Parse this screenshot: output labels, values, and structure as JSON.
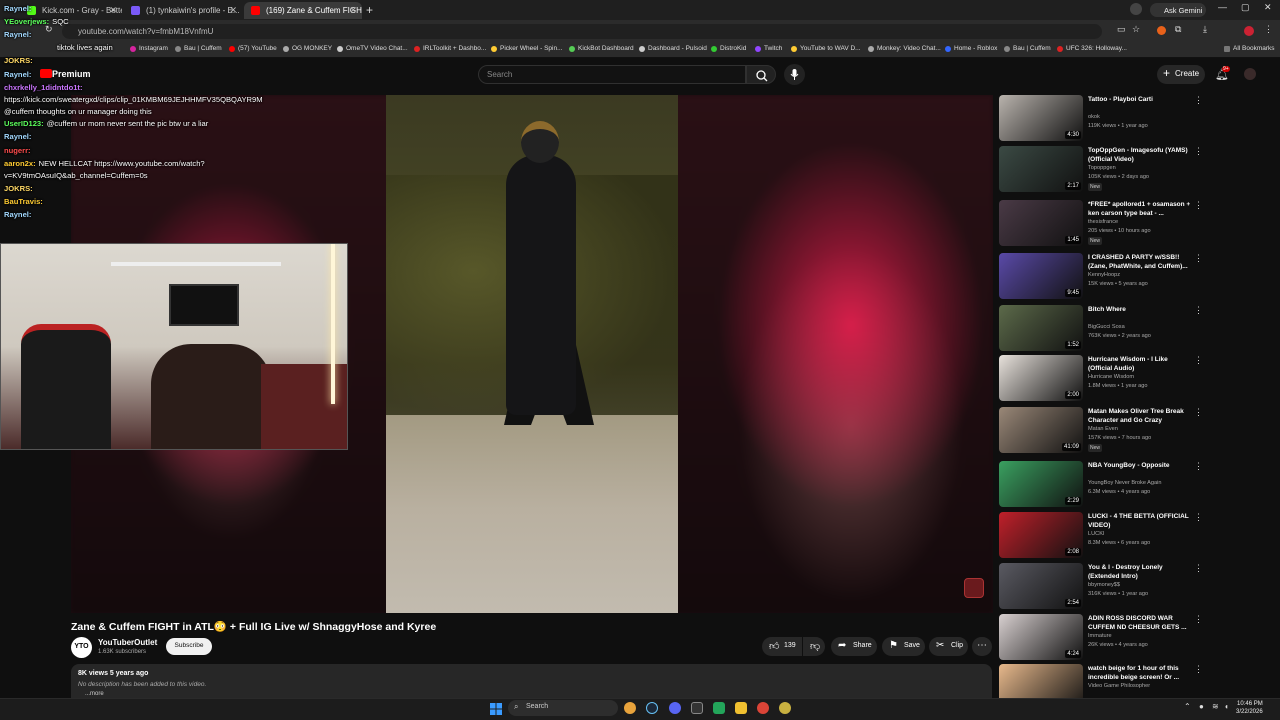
{
  "browser": {
    "tabs": [
      {
        "label": "Kick.com - Gray - Better Than You",
        "color": "#53fc18"
      },
      {
        "label": "(1) tynkaiwin's profile - E...",
        "color": "#7a5af8"
      },
      {
        "label": "(169) Zane & Cuffem FIGHT in...",
        "color": "#ff0000"
      }
    ],
    "url": "youtube.com/watch?v=fmbM18VnfmU",
    "ask_gemini": "Ask Gemini",
    "bookmarks": [
      "Instagram",
      "Bau | Cuffem",
      "(57) YouTube",
      "OG MONKEY",
      "OmeTV Video Chat...",
      "IRLToolkit + Dashbo...",
      "Picker Wheel - Spin...",
      "KickBot Dashboard",
      "Dashboard - Pulsoid",
      "DistroKid",
      "Twitch",
      "YouTube to WAV D...",
      "Monkey: Video Chat...",
      "Home - Roblox",
      "Bau | Cuffem",
      "UFC 326: Holloway..."
    ],
    "all_bookmarks": "All Bookmarks"
  },
  "youtube": {
    "logo_text": "Premium",
    "search_placeholder": "Search",
    "create_label": "Create",
    "notif_count": "9+"
  },
  "chat": [
    {
      "user": "Raynel:",
      "msg": "",
      "color": "#a3d9ff"
    },
    {
      "user": "YEoverjews:",
      "msg": "SQC",
      "color": "#5cff5c"
    },
    {
      "user": "Raynel:",
      "msg": "",
      "color": "#a3d9ff"
    },
    {
      "user": "tiktok lives again",
      "msg": "",
      "color": "#ffffff"
    },
    {
      "user": "JOKRS:",
      "msg": "",
      "color": "#ffd966"
    },
    {
      "user": "Raynel:",
      "msg": "",
      "color": "#a3d9ff"
    },
    {
      "user": "chxrkelly_1didntdo1t:",
      "msg": "",
      "color": "#cc77ff"
    },
    {
      "user": "",
      "msg": "https://kick.com/sweatergxd/clips/clip_01KMBM69JEJHHMFV35QBQAYR9M",
      "color": "#ffffff"
    },
    {
      "user": "",
      "msg": "@cuffem thoughts on ur manager doing this",
      "color": "#ffffff"
    },
    {
      "user": "UserID123:",
      "msg": "@cuffem ur mom never sent the pic btw ur a liar",
      "color": "#5cff5c"
    },
    {
      "user": "Raynel:",
      "msg": "",
      "color": "#a3d9ff"
    },
    {
      "user": "nugerr:",
      "msg": "",
      "color": "#ff4d4d"
    },
    {
      "user": "aaron2x:",
      "msg": "NEW HELLCAT https://www.youtube.com/watch?",
      "color": "#ffcc33"
    },
    {
      "user": "",
      "msg": "v=KV9tmOAsuIQ&ab_channel=Cuffem=0s",
      "color": "#ffffff"
    },
    {
      "user": "JOKRS:",
      "msg": "",
      "color": "#ffd966"
    },
    {
      "user": "BauTravis:",
      "msg": "",
      "color": "#ffcc33"
    },
    {
      "user": "Raynel:",
      "msg": "",
      "color": "#a3d9ff"
    }
  ],
  "video": {
    "title": "Zane & Cuffem FIGHT in ATL😳 + Full IG Live w/ ShnaggyHose and Kyree",
    "channel": "YouTuberOutlet",
    "channel_avatar": "YTO",
    "subscribers": "1.63K subscribers",
    "subscribe_label": "Subscribe",
    "likes": "139",
    "share_label": "Share",
    "save_label": "Save",
    "clip_label": "Clip",
    "views_date": "8K views  5 years ago",
    "description": "No description has been added to this video.",
    "more_label": "...more"
  },
  "recommendations": [
    {
      "title": "Tattoo - Playboi Carti",
      "channel": "okok",
      "meta": "119K views • 1 year ago",
      "duration": "4:30",
      "new": false,
      "thumb": "#b9b3ad"
    },
    {
      "title": "TopOppGen - Imagesofu (YAMS) (Official Video)",
      "channel": "Topoppgen",
      "meta": "105K views • 2 days ago",
      "duration": "2:17",
      "new": true,
      "thumb": "#3b4a44"
    },
    {
      "title": "*FREE* apollored1 + osamason + ken carson type beat - ...",
      "channel": "thesisfrance",
      "meta": "205 views • 10 hours ago",
      "duration": "1:45",
      "new": true,
      "thumb": "#4a3a46"
    },
    {
      "title": "I CRASHED A PARTY w/SSB!! (Zane, PhatWhite, and Cuffem)...",
      "channel": "KennyHoopz",
      "meta": "15K views • 5 years ago",
      "duration": "9:45",
      "new": false,
      "thumb": "#5a4aa8"
    },
    {
      "title": "Bitch Where",
      "channel": "BigGucci Sosa",
      "meta": "763K views • 2 years ago",
      "duration": "1:52",
      "new": false,
      "thumb": "#5c6a4a"
    },
    {
      "title": "Hurricane Wisdom - I Like (Official Audio)",
      "channel": "Hurricane Wisdom",
      "meta": "1.8M views • 1 year ago",
      "duration": "2:00",
      "new": false,
      "thumb": "#e8e2dc"
    },
    {
      "title": "Matan Makes Oliver Tree Break Character and Go Crazy",
      "channel": "Matan Even",
      "meta": "157K views • 7 hours ago",
      "duration": "41:09",
      "new": true,
      "thumb": "#9a8878"
    },
    {
      "title": "NBA YoungBoy - Opposite",
      "channel": "YoungBoy Never Broke Again",
      "meta": "6.3M views • 4 years ago",
      "duration": "2:29",
      "new": false,
      "thumb": "#3aa060"
    },
    {
      "title": "LUCKI - 4 THE BETTA (OFFICIAL VIDEO)",
      "channel": "LUCKI",
      "meta": "8.3M views • 6 years ago",
      "duration": "2:08",
      "new": false,
      "thumb": "#c0202a"
    },
    {
      "title": "You & I - Destroy Lonely (Extended Intro)",
      "channel": "bbymoney$$",
      "meta": "316K views • 1 year ago",
      "duration": "2:54",
      "new": false,
      "thumb": "#5a5a62"
    },
    {
      "title": "ADIN ROSS DISCORD WAR CUFFEM ND CHEESUR GETS ...",
      "channel": "Immature",
      "meta": "26K views • 4 years ago",
      "duration": "4:24",
      "new": false,
      "thumb": "#d8d0d0"
    },
    {
      "title": "watch beige for 1 hour of this incredible beige screen! Or ...",
      "channel": "Video Game Philosopher",
      "meta": "",
      "duration": "",
      "new": false,
      "thumb": "#e8b98c"
    }
  ],
  "new_badge": "New",
  "taskbar": {
    "search_label": "Search",
    "time": "10:46 PM",
    "date": "3/22/2026"
  }
}
